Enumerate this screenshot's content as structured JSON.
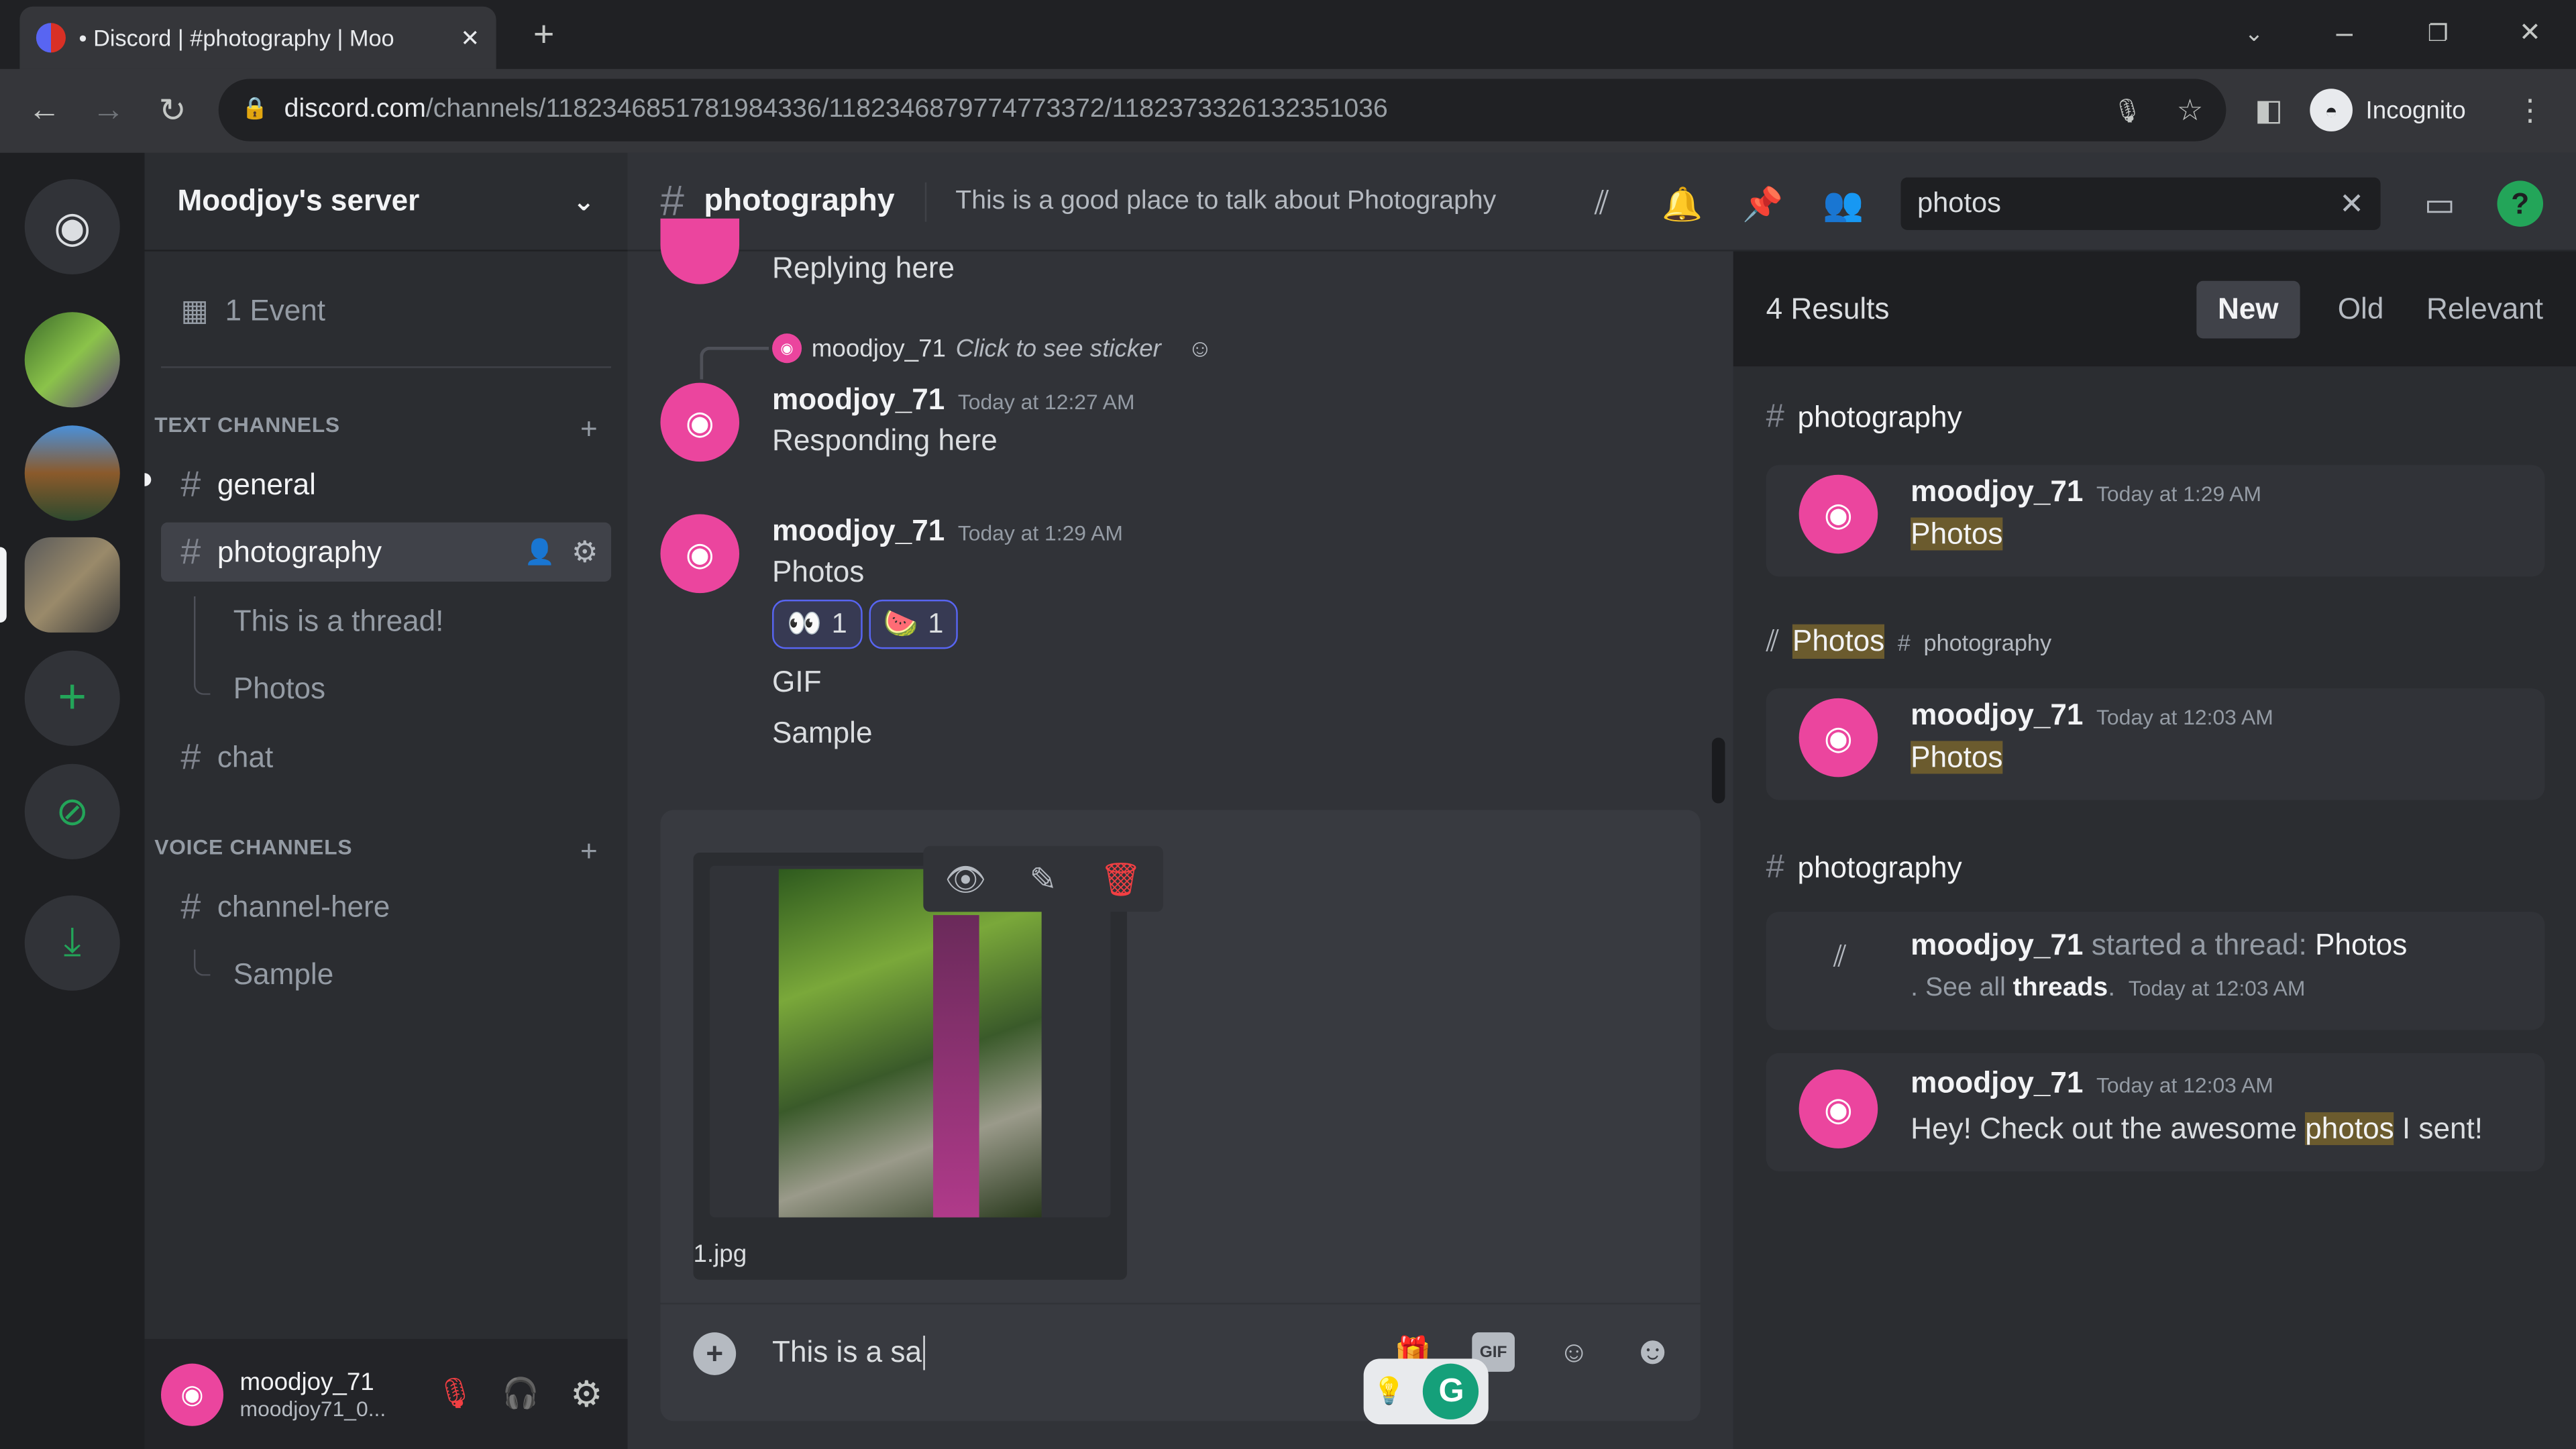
{
  "browser": {
    "tab_title": "• Discord | #photography | Moo",
    "url_domain": "discord.com",
    "url_path": "/channels/1182346851781984336/1182346879774773372/1182373326132351036",
    "profile": "Incognito"
  },
  "server": {
    "name": "Moodjoy's server",
    "event": "1 Event"
  },
  "categories": {
    "text": "TEXT CHANNELS",
    "voice": "VOICE CHANNELS"
  },
  "channels": [
    {
      "name": "general"
    },
    {
      "name": "photography"
    },
    {
      "name": "This is a thread!"
    },
    {
      "name": "Photos"
    },
    {
      "name": "chat"
    },
    {
      "name": "channel-here"
    },
    {
      "name": "Sample"
    }
  ],
  "user": {
    "name": "moodjoy_71",
    "tag": "moodjoy71_0..."
  },
  "header": {
    "channel": "photography",
    "topic": "This is a good place to talk about Photography"
  },
  "search": {
    "value": "photos"
  },
  "messages": {
    "m0": {
      "text": "Replying here"
    },
    "reply": {
      "author": "moodjoy_71",
      "text": "Click to see sticker"
    },
    "m1": {
      "author": "moodjoy_71",
      "time": "Today at 12:27 AM",
      "text": "Responding here"
    },
    "m2": {
      "author": "moodjoy_71",
      "time": "Today at 1:29 AM",
      "text": "Photos",
      "reactions": [
        {
          "emoji": "👀",
          "count": "1"
        },
        {
          "emoji": "🍉",
          "count": "1"
        }
      ],
      "line2": "GIF",
      "line3": "Sample"
    }
  },
  "upload": {
    "filename": "1.jpg"
  },
  "composer": {
    "value": "This is a sa"
  },
  "results": {
    "count": "4 Results",
    "sort": [
      "New",
      "Old",
      "Relevant"
    ],
    "g1": "photography",
    "r1": {
      "author": "moodjoy_71",
      "time": "Today at 1:29 AM",
      "text": "Photos"
    },
    "g2": {
      "thread": "Photos",
      "channel": "photography"
    },
    "r2": {
      "author": "moodjoy_71",
      "time": "Today at 12:03 AM",
      "text": "Photos"
    },
    "g3": "photography",
    "r3": {
      "author": "moodjoy_71",
      "a": "started a thread:",
      "thread": "Photos",
      "b": ". See all",
      "c": "threads",
      "d": ".",
      "time": "Today at 12:03 AM"
    },
    "r4": {
      "author": "moodjoy_71",
      "time": "Today at 12:03 AM",
      "pre": "Hey! Check out the awesome",
      "hl": "photos",
      "post": "I sent!"
    }
  },
  "colors": {
    "avatar": "#eb459e",
    "accent": "#5865f2",
    "highlight": "#6b5b2e"
  }
}
